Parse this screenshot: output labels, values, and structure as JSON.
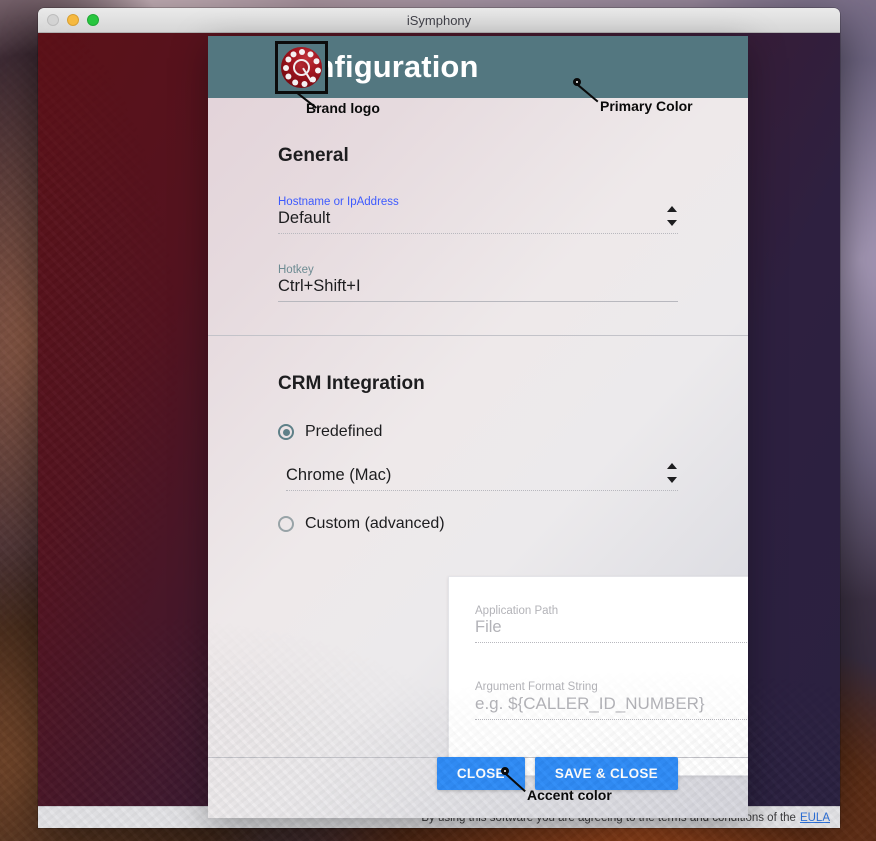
{
  "window": {
    "title": "iSymphony",
    "traffic_lights": [
      "close",
      "minimize",
      "maximize"
    ],
    "eula_text": "By using this software you are agreeing to the terms and conditions of the",
    "eula_link": "EULA"
  },
  "dialog": {
    "title": "Configuration",
    "logo_name": "rotary-phone-logo"
  },
  "annotations": [
    {
      "label": "Brand logo",
      "target": "logo"
    },
    {
      "label": "Primary Color",
      "target": "header-background"
    },
    {
      "label": "Accent color",
      "target": "close-button"
    }
  ],
  "general": {
    "heading": "General",
    "hostname": {
      "label": "Hostname or IpAddress",
      "value": "Default"
    },
    "hotkey": {
      "label": "Hotkey",
      "value": "Ctrl+Shift+I"
    }
  },
  "crm": {
    "heading": "CRM Integration",
    "predefined": {
      "label": "Predefined",
      "selected": true,
      "dropdown_value": "Chrome (Mac)"
    },
    "custom": {
      "label": "Custom (advanced)",
      "selected": false,
      "application_path": {
        "label": "Application Path",
        "value": "File"
      },
      "argument_format": {
        "label": "Argument Format String",
        "placeholder": "e.g. ${CALLER_ID_NUMBER}"
      }
    }
  },
  "footer": {
    "close_label": "CLOSE",
    "save_close_label": "SAVE & CLOSE"
  },
  "colors": {
    "primary": "#537780",
    "accent": "#2f8cf7",
    "label_focus": "#3d5afe",
    "brand_red": "#a2141f"
  }
}
